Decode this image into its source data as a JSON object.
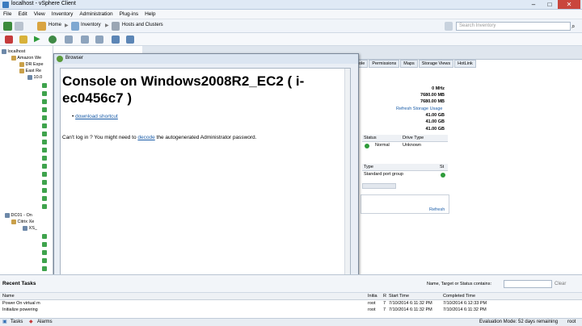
{
  "window": {
    "title": "localhost - vSphere Client"
  },
  "menu": [
    "File",
    "Edit",
    "View",
    "Inventory",
    "Administration",
    "Plug-ins",
    "Help"
  ],
  "nav": {
    "home": "Home",
    "inventory": "Inventory",
    "hosts_clusters": "Hosts and Clusters",
    "search_placeholder": "Search Inventory"
  },
  "tree": {
    "items": [
      {
        "label": "localhost"
      },
      {
        "label": "Amazon We"
      },
      {
        "label": "DR Expe"
      },
      {
        "label": "East Re"
      },
      {
        "label": "10.0"
      },
      {
        "label": "DC01 - On"
      },
      {
        "label": "Citrix Xe"
      },
      {
        "label": "XS_"
      }
    ]
  },
  "right": {
    "tabs": [
      "ole",
      "Permissions",
      "Maps",
      "Storage Views",
      "HotLink"
    ],
    "values": [
      "0 MHz",
      "7680.00 MB",
      "7680.00 MB",
      "41.00 GB",
      "41.00 GB",
      "41.00 GB"
    ],
    "refresh_storage": "Refresh Storage Usage",
    "storage_grid": {
      "headers": [
        "Status",
        "Drive Type"
      ],
      "row": [
        "Normal",
        "Unknown"
      ]
    },
    "network_grid": {
      "headers": [
        "Type",
        "St"
      ],
      "row": [
        "Standard port group"
      ]
    },
    "refresh": "Refresh"
  },
  "browser": {
    "title": "Browser",
    "heading": "Console on Windows2008R2_EC2 ( i-ec0456c7 )",
    "download_link": "download shortcut",
    "cant_log_prefix": "Can't log in ? You might need to",
    "decode_link": "decode",
    "cant_log_suffix": "the autogenerated Administrator password."
  },
  "recent_tasks": {
    "title": "Recent Tasks",
    "filter_label": "Name, Target or Status contains:",
    "clear": "Clear",
    "headers": {
      "name": "Name",
      "initiated": "Initia",
      "requested": "R",
      "start": "Start Time",
      "completed": "Completed Time"
    },
    "rows": [
      {
        "name": "Power On virtual m",
        "initiated": "root",
        "requested": "7",
        "start": "7/10/2014 6:11:32 PM",
        "completed": "7/10/2014 6:12:33 PM"
      },
      {
        "name": "Initialize powering",
        "initiated": "root",
        "requested": "7",
        "start": "7/10/2014 6:11:32 PM",
        "completed": "7/10/2014 6:11:32 PM"
      }
    ]
  },
  "statusbar": {
    "tasks": "Tasks",
    "alarms": "Alarms",
    "evaluation": "Evaluation Mode: 52 days remaining",
    "user": "root"
  },
  "colors": {
    "accent": "#1a5ca8",
    "vm_green": "#3fa34d"
  }
}
